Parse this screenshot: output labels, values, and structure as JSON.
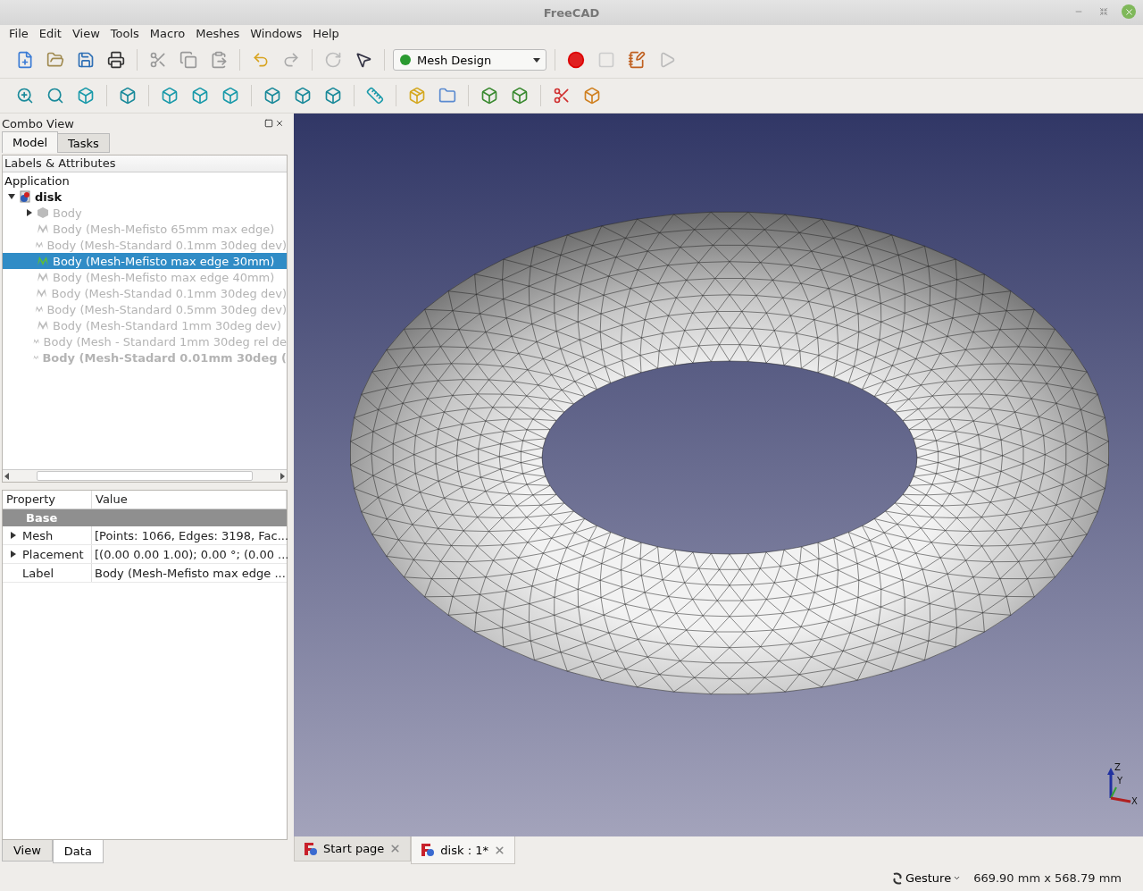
{
  "window": {
    "title": "FreeCAD"
  },
  "menu": [
    "File",
    "Edit",
    "View",
    "Tools",
    "Macro",
    "Meshes",
    "Windows",
    "Help"
  ],
  "workbench": {
    "value": "Mesh Design"
  },
  "combo_view": {
    "title": "Combo View",
    "tabs": [
      {
        "label": "Model",
        "selected": true
      },
      {
        "label": "Tasks",
        "selected": false
      }
    ],
    "tree": {
      "header": "Labels & Attributes",
      "root": "Application",
      "items": [
        {
          "label": "disk",
          "kind": "document",
          "expanded": true,
          "visible": true,
          "selected": false,
          "bold": true,
          "children": [
            {
              "label": "Body",
              "kind": "body",
              "expanded": false,
              "visible": false,
              "selected": false,
              "bold": false
            },
            {
              "label": "Body (Mesh-Mefisto 65mm max edge)",
              "kind": "mesh",
              "visible": false,
              "selected": false,
              "bold": false
            },
            {
              "label": "Body (Mesh-Standard 0.1mm 30deg dev)",
              "kind": "mesh",
              "visible": false,
              "selected": false,
              "bold": false
            },
            {
              "label": "Body (Mesh-Mefisto max edge 30mm)",
              "kind": "mesh",
              "visible": true,
              "selected": true,
              "bold": false
            },
            {
              "label": "Body (Mesh-Mefisto max edge 40mm)",
              "kind": "mesh",
              "visible": false,
              "selected": false,
              "bold": false
            },
            {
              "label": "Body (Mesh-Standad 0.1mm 30deg dev)",
              "kind": "mesh",
              "visible": false,
              "selected": false,
              "bold": false
            },
            {
              "label": "Body (Mesh-Standard 0.5mm 30deg dev)",
              "kind": "mesh",
              "visible": false,
              "selected": false,
              "bold": false
            },
            {
              "label": "Body (Mesh-Standard 1mm 30deg dev)",
              "kind": "mesh",
              "visible": false,
              "selected": false,
              "bold": false
            },
            {
              "label": "Body (Mesh - Standard 1mm 30deg rel de",
              "kind": "mesh",
              "visible": false,
              "selected": false,
              "bold": false
            },
            {
              "label": "Body (Mesh-Stadard 0.01mm 30deg (",
              "kind": "mesh",
              "visible": false,
              "selected": false,
              "bold": true
            }
          ]
        }
      ]
    },
    "properties": {
      "columns": [
        "Property",
        "Value"
      ],
      "groups": [
        {
          "name": "Base",
          "rows": [
            {
              "property": "Mesh",
              "value": "[Points: 1066, Edges: 3198, Fac...",
              "expanded": false
            },
            {
              "property": "Placement",
              "value": "[(0.00 0.00 1.00); 0.00 °; (0.00 ...",
              "expanded": false
            },
            {
              "property": "Label",
              "value": "Body (Mesh-Mefisto max edge ..."
            }
          ]
        }
      ]
    },
    "bottom_tabs": [
      {
        "label": "View",
        "selected": false
      },
      {
        "label": "Data",
        "selected": true
      }
    ]
  },
  "viewport": {
    "axes": [
      "Z",
      "Y",
      "X"
    ]
  },
  "document_tabs": [
    {
      "label": "Start page",
      "selected": false
    },
    {
      "label": "disk : 1*",
      "selected": true
    }
  ],
  "status_bar": {
    "navigation": "Gesture",
    "dimensions": "669.90 mm x 568.79 mm"
  }
}
